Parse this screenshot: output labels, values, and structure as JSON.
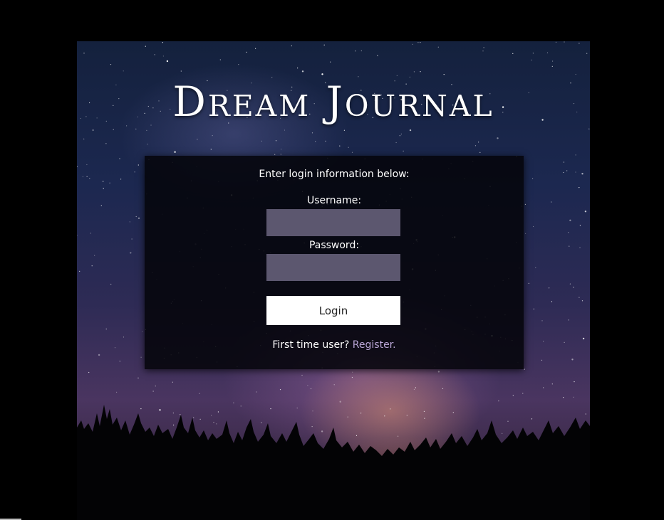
{
  "app": {
    "title": "Dream Journal"
  },
  "login": {
    "instructions": "Enter login information below:",
    "username_label": "Username:",
    "username_value": "",
    "password_label": "Password:",
    "password_value": "",
    "login_button": "Login",
    "register_prompt": "First time user?",
    "register_link": "Register."
  },
  "colors": {
    "panel_bg": "#05050a",
    "input_bg": "#5c576f",
    "button_bg": "#ffffff",
    "link": "#b9a6d6"
  }
}
